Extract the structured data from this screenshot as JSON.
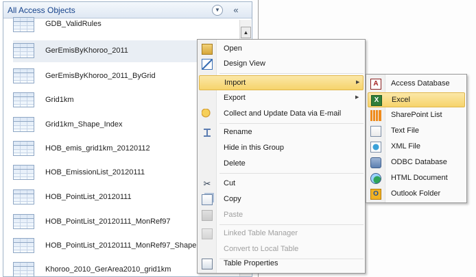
{
  "nav_pane": {
    "title": "All Access Objects",
    "dropdown_icon": "chevron-down-circle-icon",
    "collapse_icon": "double-chevron-left-icon",
    "items": [
      {
        "label": "GDB_ValidRules",
        "selected": false
      },
      {
        "label": "GerEmisByKhoroo_2011",
        "selected": true
      },
      {
        "label": "GerEmisByKhoroo_2011_ByGrid",
        "selected": false
      },
      {
        "label": "Grid1km",
        "selected": false
      },
      {
        "label": "Grid1km_Shape_Index",
        "selected": false
      },
      {
        "label": "HOB_emis_grid1km_20120112",
        "selected": false
      },
      {
        "label": "HOB_EmissionList_20120111",
        "selected": false
      },
      {
        "label": "HOB_PointList_20120111",
        "selected": false
      },
      {
        "label": "HOB_PointList_20120111_MonRef97",
        "selected": false
      },
      {
        "label": "HOB_PointList_20120111_MonRef97_Shape",
        "selected": false
      },
      {
        "label": "Khoroo_2010_GerArea2010_grid1km",
        "selected": false
      }
    ]
  },
  "context_menu": {
    "items": [
      {
        "label": "Open",
        "icon": "open-icon",
        "enabled": true
      },
      {
        "label": "Design View",
        "icon": "design-view-icon",
        "enabled": true
      },
      {
        "label": "Import",
        "icon": "",
        "enabled": true,
        "submenu": true,
        "highlighted": true
      },
      {
        "label": "Export",
        "icon": "",
        "enabled": true,
        "submenu": true
      },
      {
        "label": "Collect and Update Data via E-mail",
        "icon": "collect-data-icon",
        "enabled": true
      },
      {
        "label": "Rename",
        "icon": "rename-icon",
        "enabled": true
      },
      {
        "label": "Hide in this Group",
        "icon": "",
        "enabled": true
      },
      {
        "label": "Delete",
        "icon": "",
        "enabled": true
      },
      {
        "label": "Cut",
        "icon": "cut-icon",
        "enabled": true
      },
      {
        "label": "Copy",
        "icon": "copy-icon",
        "enabled": true
      },
      {
        "label": "Paste",
        "icon": "paste-icon",
        "enabled": false
      },
      {
        "label": "Linked Table Manager",
        "icon": "linked-table-icon",
        "enabled": false
      },
      {
        "label": "Convert to Local Table",
        "icon": "",
        "enabled": false
      },
      {
        "label": "Table Properties",
        "icon": "table-properties-icon",
        "enabled": true
      }
    ]
  },
  "import_submenu": {
    "items": [
      {
        "label": "Access Database",
        "icon": "access-database-icon",
        "glyph": "A"
      },
      {
        "label": "Excel",
        "icon": "excel-icon",
        "glyph": "X",
        "highlighted": true
      },
      {
        "label": "SharePoint List",
        "icon": "sharepoint-list-icon",
        "glyph": ""
      },
      {
        "label": "Text File",
        "icon": "text-file-icon",
        "glyph": ""
      },
      {
        "label": "XML File",
        "icon": "xml-file-icon",
        "glyph": ""
      },
      {
        "label": "ODBC Database",
        "icon": "odbc-database-icon",
        "glyph": ""
      },
      {
        "label": "HTML Document",
        "icon": "html-document-icon",
        "glyph": ""
      },
      {
        "label": "Outlook Folder",
        "icon": "outlook-folder-icon",
        "glyph": "O"
      }
    ]
  },
  "colors": {
    "highlight": "#f6d46b",
    "nav_title": "#15428b",
    "disabled_text": "#a0a0a0"
  }
}
